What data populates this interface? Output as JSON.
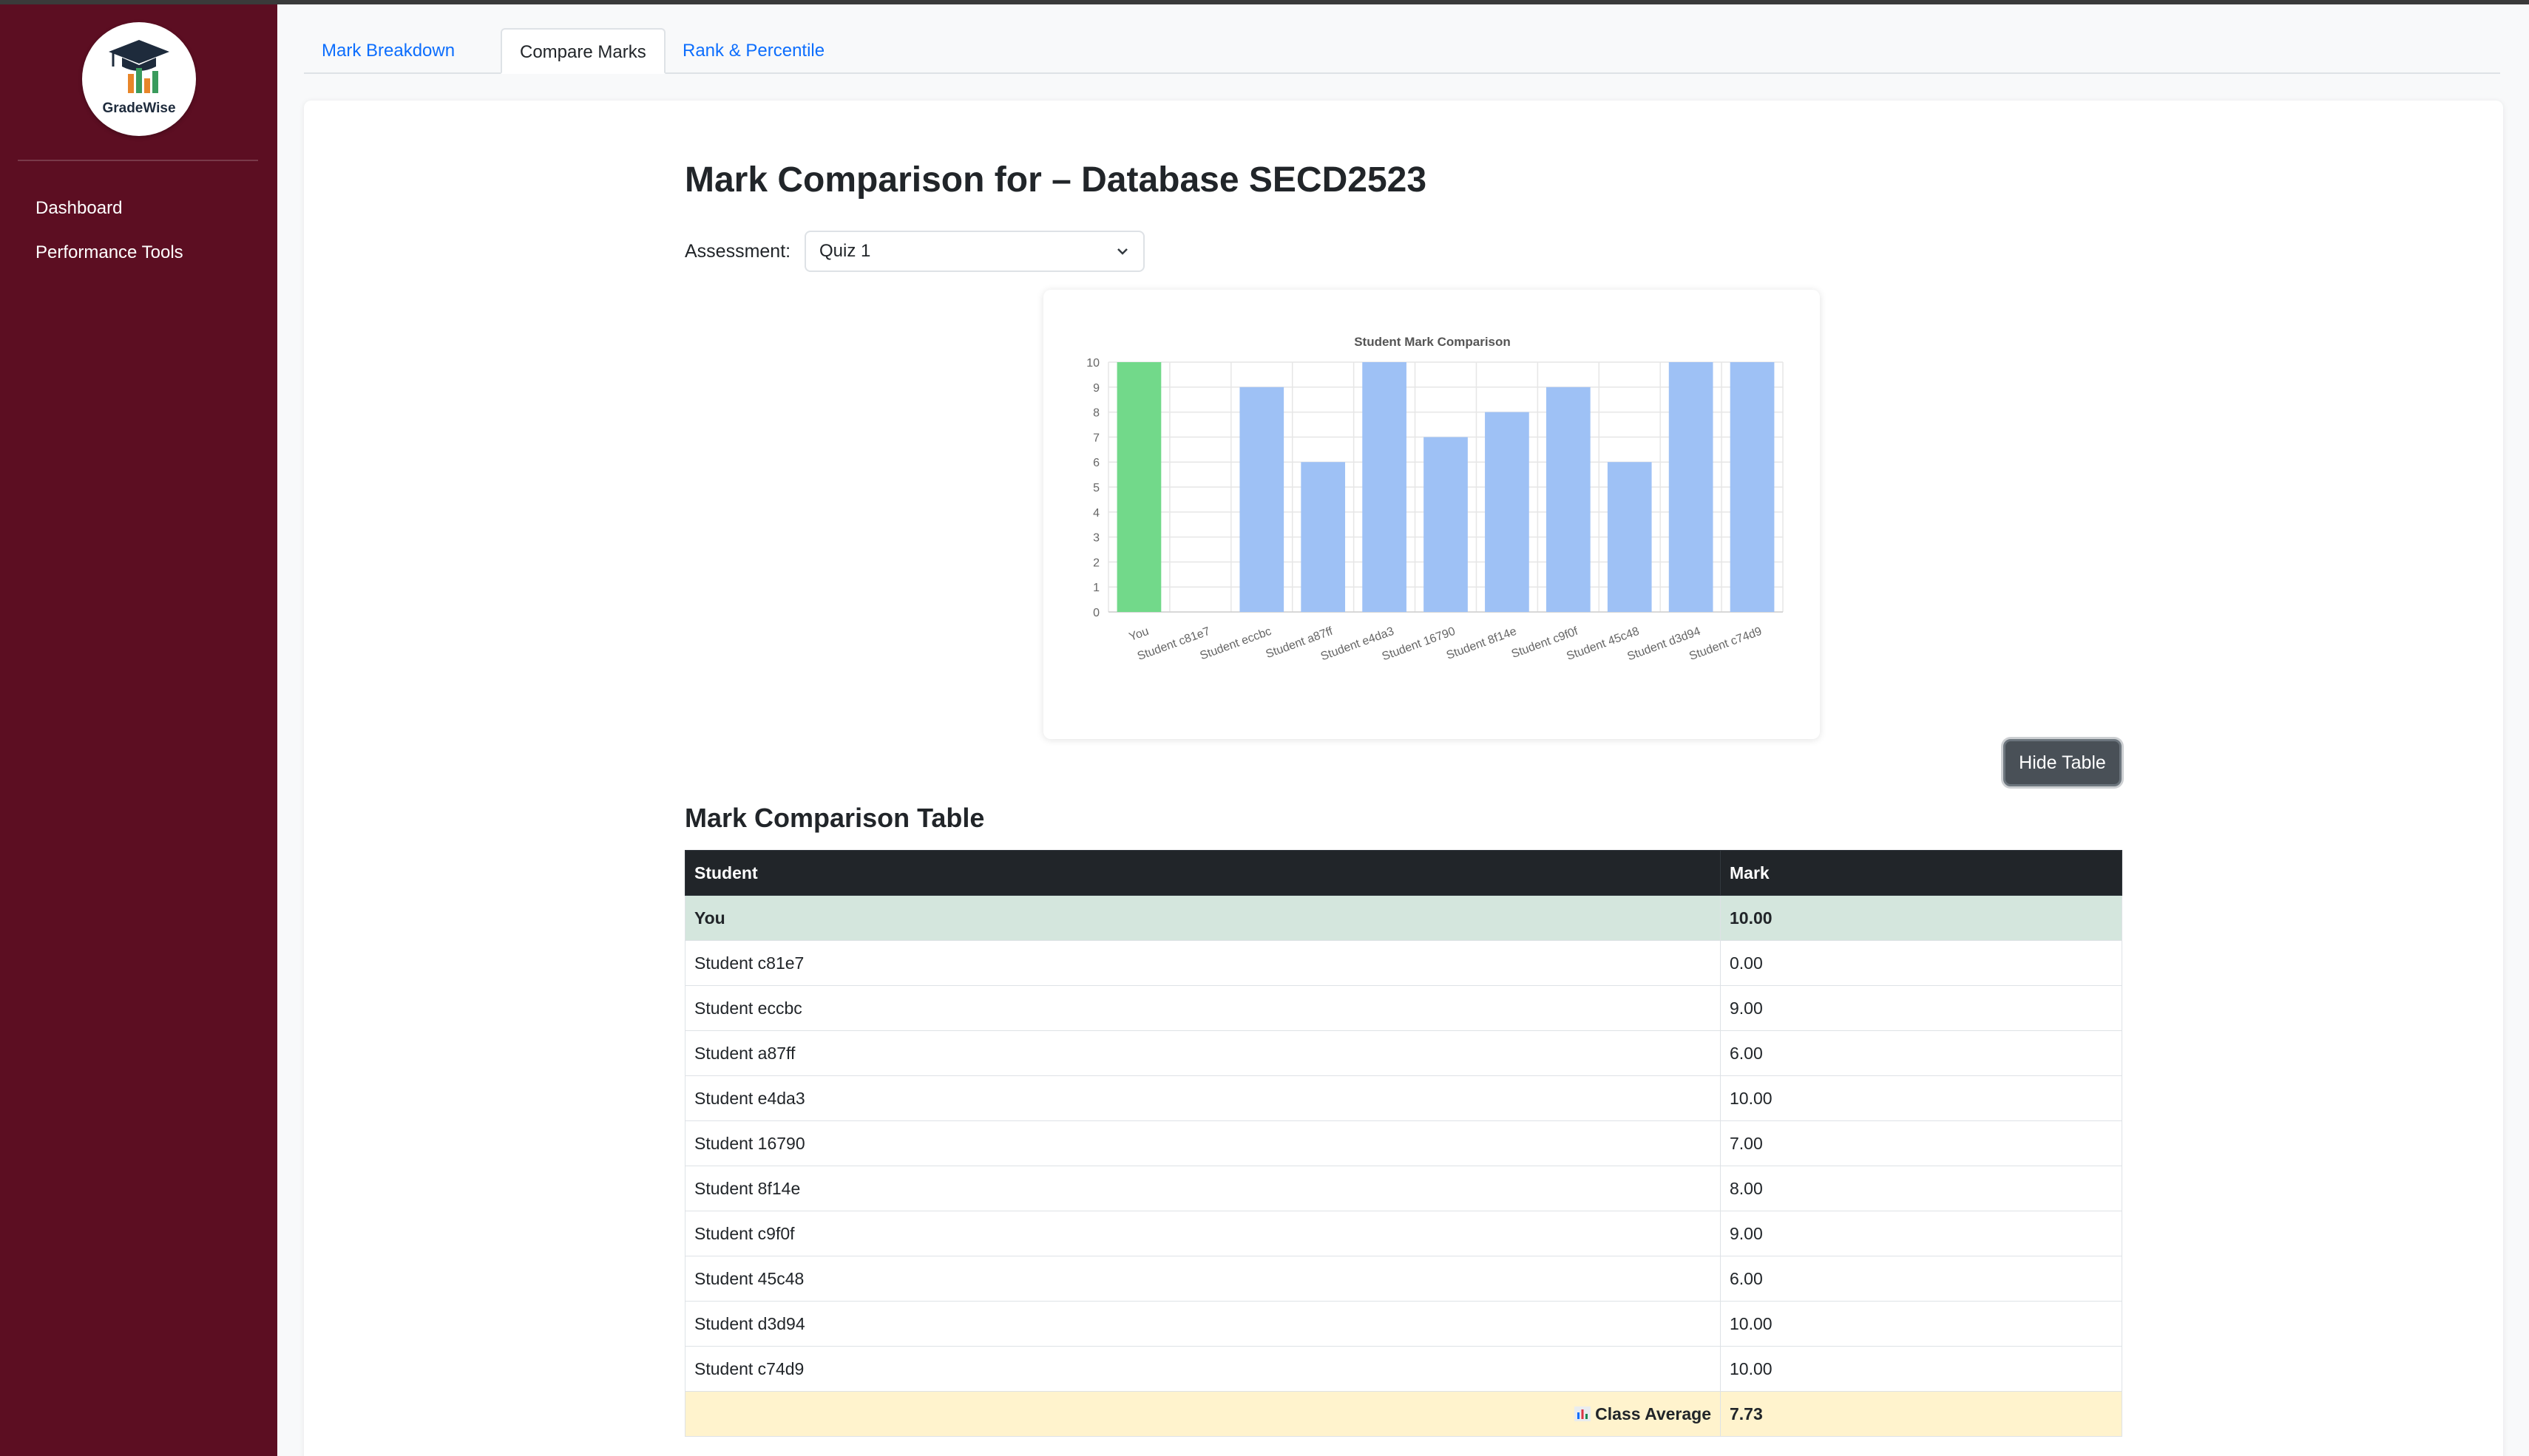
{
  "app": {
    "name": "GradeWise"
  },
  "sidebar": {
    "items": [
      {
        "label": "Dashboard"
      },
      {
        "label": "Performance Tools"
      }
    ]
  },
  "tabs": [
    {
      "label": "Mark Breakdown",
      "active": false
    },
    {
      "label": "Compare Marks",
      "active": true
    },
    {
      "label": "Rank & Percentile",
      "active": false
    }
  ],
  "page": {
    "title": "Mark Comparison for – Database SECD2523",
    "assessment_label": "Assessment:",
    "assessment_value": "Quiz 1",
    "hide_table_label": "Hide Table",
    "table_title": "Mark Comparison Table"
  },
  "colors": {
    "sidebar": "#5c0e22",
    "you_bar": "#72d98a",
    "other_bar": "#9ec1f5",
    "you_row": "#d4e6dd",
    "avg_row": "#fff3cd"
  },
  "chart_data": {
    "type": "bar",
    "title": "Student Mark Comparison",
    "categories": [
      "You",
      "Student c81e7",
      "Student eccbc",
      "Student a87ff",
      "Student e4da3",
      "Student 16790",
      "Student 8f14e",
      "Student c9f0f",
      "Student 45c48",
      "Student d3d94",
      "Student c74d9"
    ],
    "values": [
      10,
      0,
      9,
      6,
      10,
      7,
      8,
      9,
      6,
      10,
      10
    ],
    "highlight_index": 0,
    "ylim": [
      0,
      10
    ],
    "yticks": [
      0,
      1,
      2,
      3,
      4,
      5,
      6,
      7,
      8,
      9,
      10
    ],
    "grid": true,
    "legend": "none"
  },
  "table": {
    "headers": {
      "student": "Student",
      "mark": "Mark"
    },
    "rows": [
      {
        "student": "You",
        "mark": "10.00"
      },
      {
        "student": "Student c81e7",
        "mark": "0.00"
      },
      {
        "student": "Student eccbc",
        "mark": "9.00"
      },
      {
        "student": "Student a87ff",
        "mark": "6.00"
      },
      {
        "student": "Student e4da3",
        "mark": "10.00"
      },
      {
        "student": "Student 16790",
        "mark": "7.00"
      },
      {
        "student": "Student 8f14e",
        "mark": "8.00"
      },
      {
        "student": "Student c9f0f",
        "mark": "9.00"
      },
      {
        "student": "Student 45c48",
        "mark": "6.00"
      },
      {
        "student": "Student d3d94",
        "mark": "10.00"
      },
      {
        "student": "Student c74d9",
        "mark": "10.00"
      }
    ],
    "average": {
      "icon": "bar-chart-icon",
      "label": "Class Average",
      "value": "7.73"
    }
  }
}
